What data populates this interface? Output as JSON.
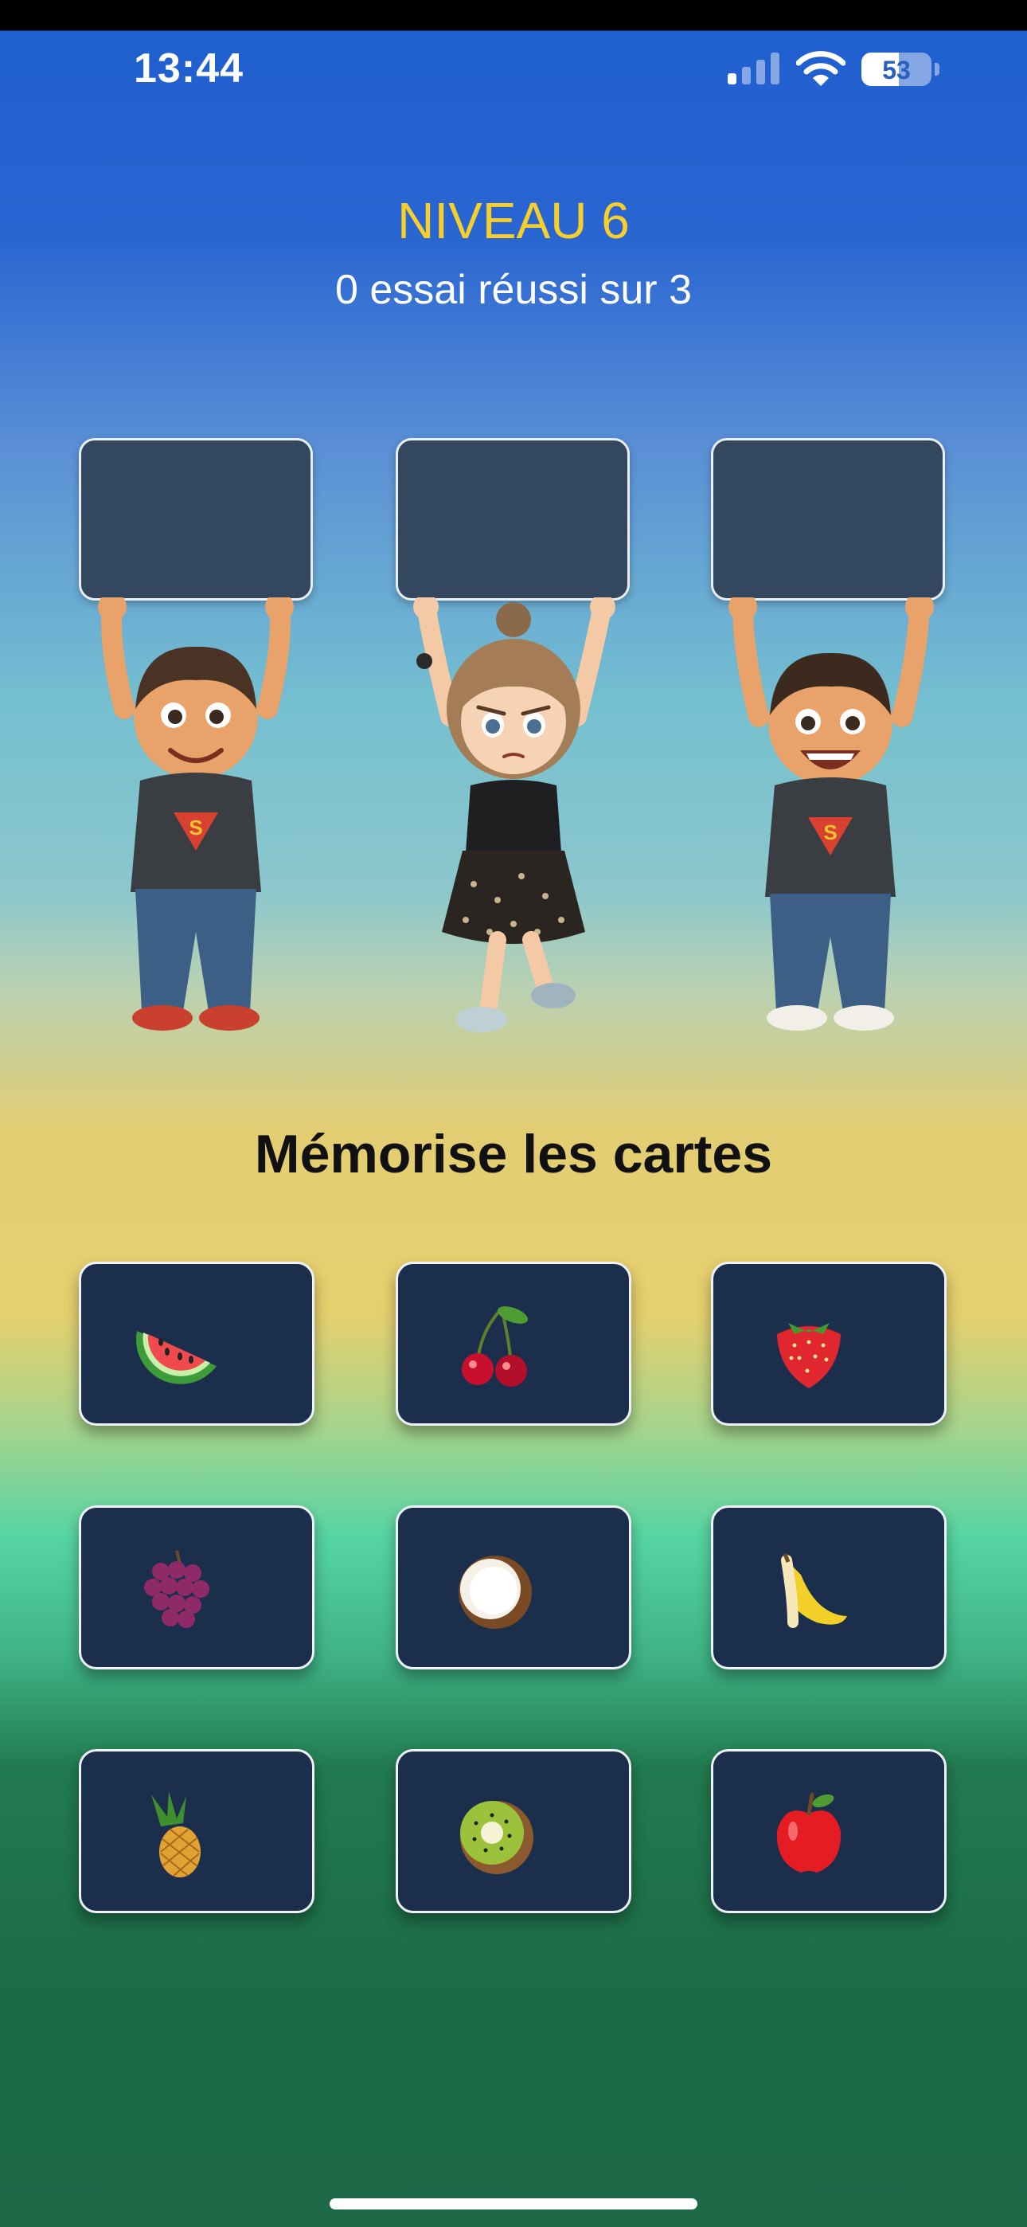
{
  "status_bar": {
    "time": "13:44",
    "signal_bars_active": 1,
    "signal_bars_total": 4,
    "battery_percent": 53,
    "battery_label": "53"
  },
  "game": {
    "level_title": "NIVEAU 6",
    "attempts_text": "0 essai réussi sur 3",
    "instruction": "Mémorise les cartes"
  },
  "signboards": [
    {
      "name": "signboard-left",
      "character": "boy-superman-shirt-smiling"
    },
    {
      "name": "signboard-middle",
      "character": "girl-hair-bun-frowning"
    },
    {
      "name": "signboard-right",
      "character": "boy-superman-shirt-laughing"
    }
  ],
  "cards": [
    {
      "fruit": "watermelon-icon"
    },
    {
      "fruit": "cherries-icon"
    },
    {
      "fruit": "strawberry-icon"
    },
    {
      "fruit": "grapes-icon"
    },
    {
      "fruit": "coconut-icon"
    },
    {
      "fruit": "banana-icon"
    },
    {
      "fruit": "pineapple-icon"
    },
    {
      "fruit": "kiwi-icon"
    },
    {
      "fruit": "apple-icon"
    }
  ],
  "colors": {
    "level_title": "#f7cf2a",
    "card_background": "#1b2e4b",
    "signboard_background": "#33475f"
  }
}
